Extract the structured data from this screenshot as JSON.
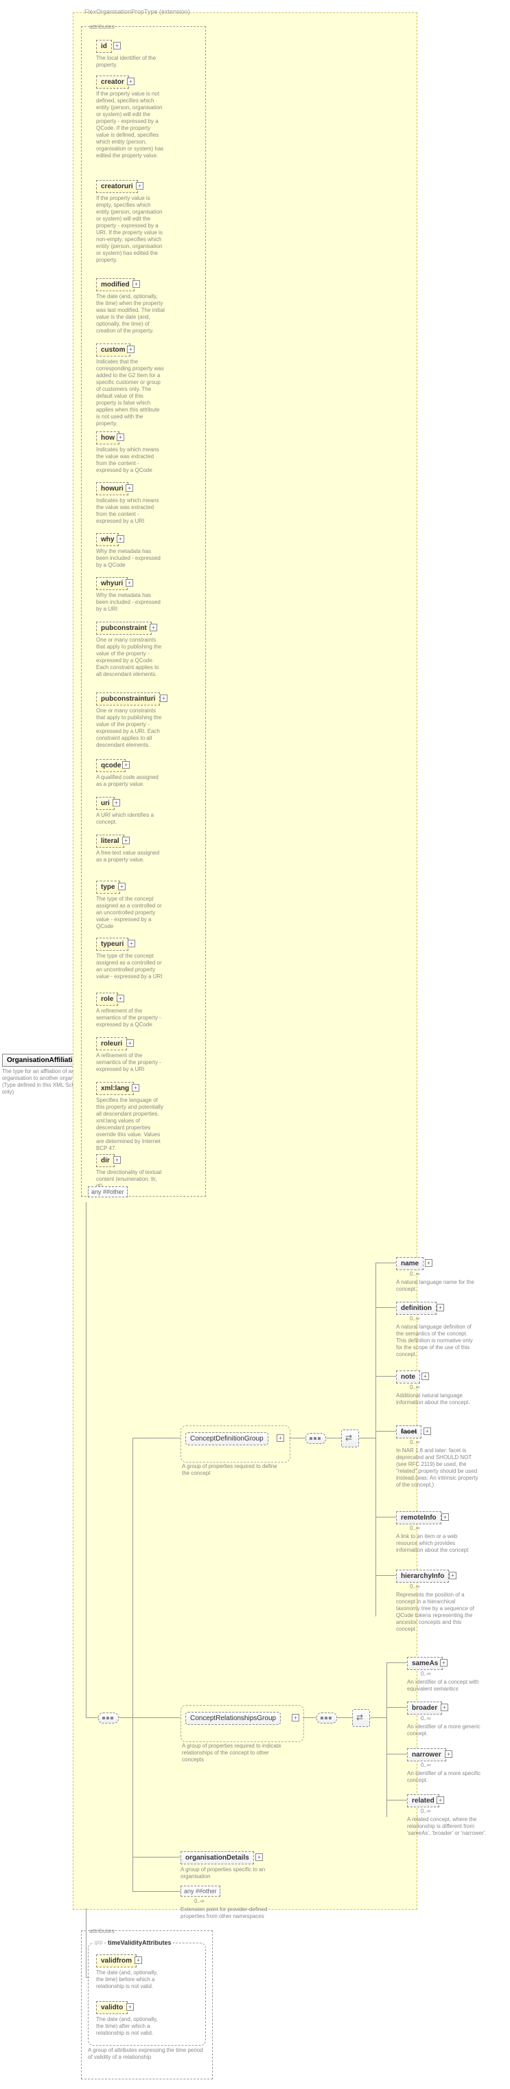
{
  "root": {
    "name": "OrganisationAffiliationType",
    "desc": "The type for an affliation of an organisation to another organisation (Type defined in this XML Schema only)"
  },
  "extension": {
    "label": "FlexOrganisationPropType (extension)"
  },
  "attributesHeader": "attributes",
  "attrs": [
    {
      "name": "id",
      "desc": "The local identifier of the property."
    },
    {
      "name": "creator",
      "desc": "If the property value is not defined, specifies which entity (person, organisation or system) will edit the property - expressed by a QCode. If the property value is defined, specifies which entity (person, organisation or system) has edited the property value."
    },
    {
      "name": "creatoruri",
      "desc": "If the property value is empty, specifies which entity (person, organisation or system) will edit the property - expressed by a URI. If the property value is non-empty, specifies which entity (person, organisation or system) has edited the property."
    },
    {
      "name": "modified",
      "desc": "The date (and, optionally, the time) when the property was last modified. The initial value is the date (and, optionally, the time) of creation of the property."
    },
    {
      "name": "custom",
      "desc": "Indicates that the corresponding property was added to the G2 Item for a specific customer or group of customers only. The default value of this property is false which applies when this attribute is not used with the property."
    },
    {
      "name": "how",
      "desc": "Indicates by which means the value was extracted from the content - expressed by a QCode"
    },
    {
      "name": "howuri",
      "desc": "Indicates by which means the value was extracted from the content - expressed by a URI"
    },
    {
      "name": "why",
      "desc": "Why the metadata has been included - expressed by a QCode"
    },
    {
      "name": "whyuri",
      "desc": "Why the metadata has been included - expressed by a URI"
    },
    {
      "name": "pubconstraint",
      "desc": "One or many constraints that apply to publishing the value of the property - expressed by a QCode. Each constraint applies to all descendant elements."
    },
    {
      "name": "pubconstrainturi",
      "desc": "One or many constraints that apply to publishing the value of the property - expressed by a URI. Each constraint applies to all descendant elements."
    },
    {
      "name": "qcode",
      "desc": "A qualified code assigned as a property value."
    },
    {
      "name": "uri",
      "desc": "A URI which identifies a concept."
    },
    {
      "name": "literal",
      "desc": "A free-text value assigned as a property value."
    },
    {
      "name": "type",
      "desc": "The type of the concept assigned as a controlled or an uncontrolled property value - expressed by a QCode"
    },
    {
      "name": "typeuri",
      "desc": "The type of the concept assigned as a controlled or an uncontrolled property value - expressed by a URI"
    },
    {
      "name": "role",
      "desc": "A refinement of the semantics of the property - expressed by a QCode"
    },
    {
      "name": "roleuri",
      "desc": "A refinement of the semantics of the property - expressed by a URI"
    },
    {
      "name": "xml:lang",
      "desc": "Specifies the language of this property and potentially all descendant properties. xml:lang values of descendant properties override this value. Values are determined by Internet BCP 47."
    },
    {
      "name": "dir",
      "desc": "The directionality of textual content (enumeration: ltr, rtl)"
    }
  ],
  "anyOther1": "any ##other",
  "groups": {
    "cdg": {
      "name": "ConceptDefinitionGroup",
      "desc": "A group of properties required to define the concept"
    },
    "crg": {
      "name": "ConceptRelationshipsGroup",
      "desc": "A group of properties required to indicate relationships of the concept to other concepts"
    }
  },
  "orgDetails": {
    "name": "organisationDetails",
    "desc": "A group of properties specific to an organisation"
  },
  "anyOther2": {
    "label": "any ##other",
    "card": "0..∞",
    "desc": "Extension point for provider-defined properties from other namespaces"
  },
  "cdgElems": [
    {
      "name": "name",
      "desc": "A natural language name for the concept."
    },
    {
      "name": "definition",
      "desc": "A natural language definition of the semantics of the concept. This definition is normative only for the scope of the use of this concept."
    },
    {
      "name": "note",
      "desc": "Additional natural language information about the concept."
    },
    {
      "name": "facet",
      "strike": true,
      "desc": "In NAR 1.8 and later: facet is deprecated and SHOULD NOT (see RFC 2119) be used, the \"related\" property should be used instead.(was: An intrinsic property of the concept.)"
    },
    {
      "name": "remoteInfo",
      "desc": "A link to an item or a web resource which provides information about the concept"
    },
    {
      "name": "hierarchyInfo",
      "desc": "Represents the position of a concept in a hierarchical taxonomy tree by a sequence of QCode tokens representing the ancestor concepts and this concept"
    }
  ],
  "crgElems": [
    {
      "name": "sameAs",
      "desc": "An identifier of a concept with equivalent semantics"
    },
    {
      "name": "broader",
      "desc": "An identifier of a more generic concept."
    },
    {
      "name": "narrower",
      "desc": "An identifier of a more specific concept."
    },
    {
      "name": "related",
      "desc": "A related concept, where the relationship is different from 'sameAs', 'broader' or 'narrower'."
    }
  ],
  "timeValidity": {
    "groupName": "timeValidityAttributes",
    "header": "attributes",
    "grp": "grp",
    "groupDesc": "A group of attributes expressing the time period of validity of a relationship",
    "attrs": [
      {
        "name": "validfrom",
        "desc": "The date (and, optionally, the time) before which a relationship is not valid."
      },
      {
        "name": "validto",
        "desc": "The date (and, optionally, the time) after which a relationship is not valid."
      }
    ]
  },
  "card": {
    "zinf": "0..∞"
  }
}
